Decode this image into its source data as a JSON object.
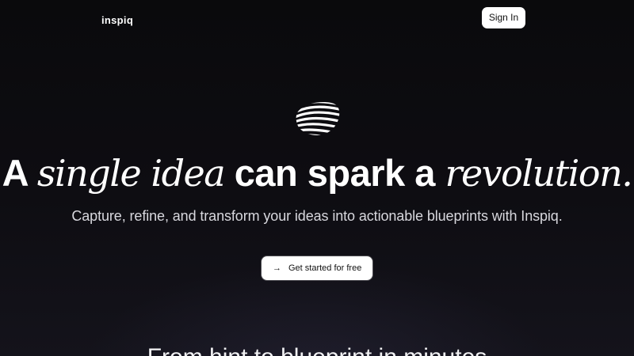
{
  "header": {
    "logo_text": "inspiq",
    "sign_in_label": "Sign In"
  },
  "hero": {
    "icon": "wave-stripes-logo-icon",
    "headline": {
      "part1": "A ",
      "part2": "single idea",
      "part3": " can spark a ",
      "part4": "revolution."
    },
    "subheadline": "Capture, refine, and transform your ideas into actionable blueprints with Inspiq.",
    "cta_label": "Get started for free",
    "cta_icon": "arrow-right-icon"
  },
  "next_section": {
    "title": "From hint to blueprint in minutes"
  },
  "colors": {
    "background": "#0d0c10",
    "text": "#ffffff",
    "button_bg": "#ffffff",
    "button_text": "#111111"
  }
}
